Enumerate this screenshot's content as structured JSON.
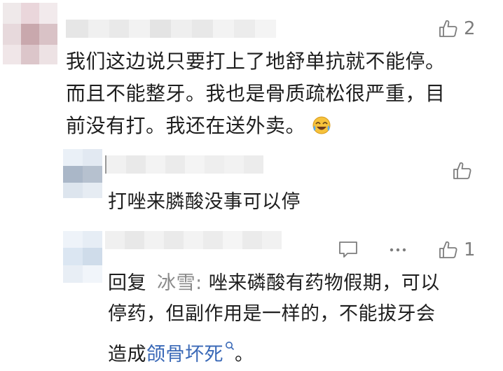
{
  "comments": [
    {
      "likes": "2",
      "text_lines": [
        "我们这边说只要打上了地舒单抗就不能停。",
        "而且不能整牙。我也是骨质疏松很严重，目",
        "前没有打。我还在送外卖。"
      ],
      "emoji": "face-with-tears-of-joy"
    }
  ],
  "replies": [
    {
      "likes": "",
      "text": "打唑来膦酸没事可以停"
    },
    {
      "likes": "1",
      "reply_prefix": "回复",
      "mention": "冰雪:",
      "text_line1": "唑来磷酸有药物假期，可以",
      "text_line2": "停药，但副作用是一样的，不能拔牙会",
      "text_line3_before": "造成",
      "text_line3_link": "颌骨坏死",
      "text_line3_after": "。"
    }
  ],
  "icons": {
    "like": "thumbs-up-outline-icon",
    "comment": "comment-bubble-icon",
    "more": "more-dots-icon",
    "search": "search-icon",
    "emoji": "face-with-tears-of-joy"
  }
}
